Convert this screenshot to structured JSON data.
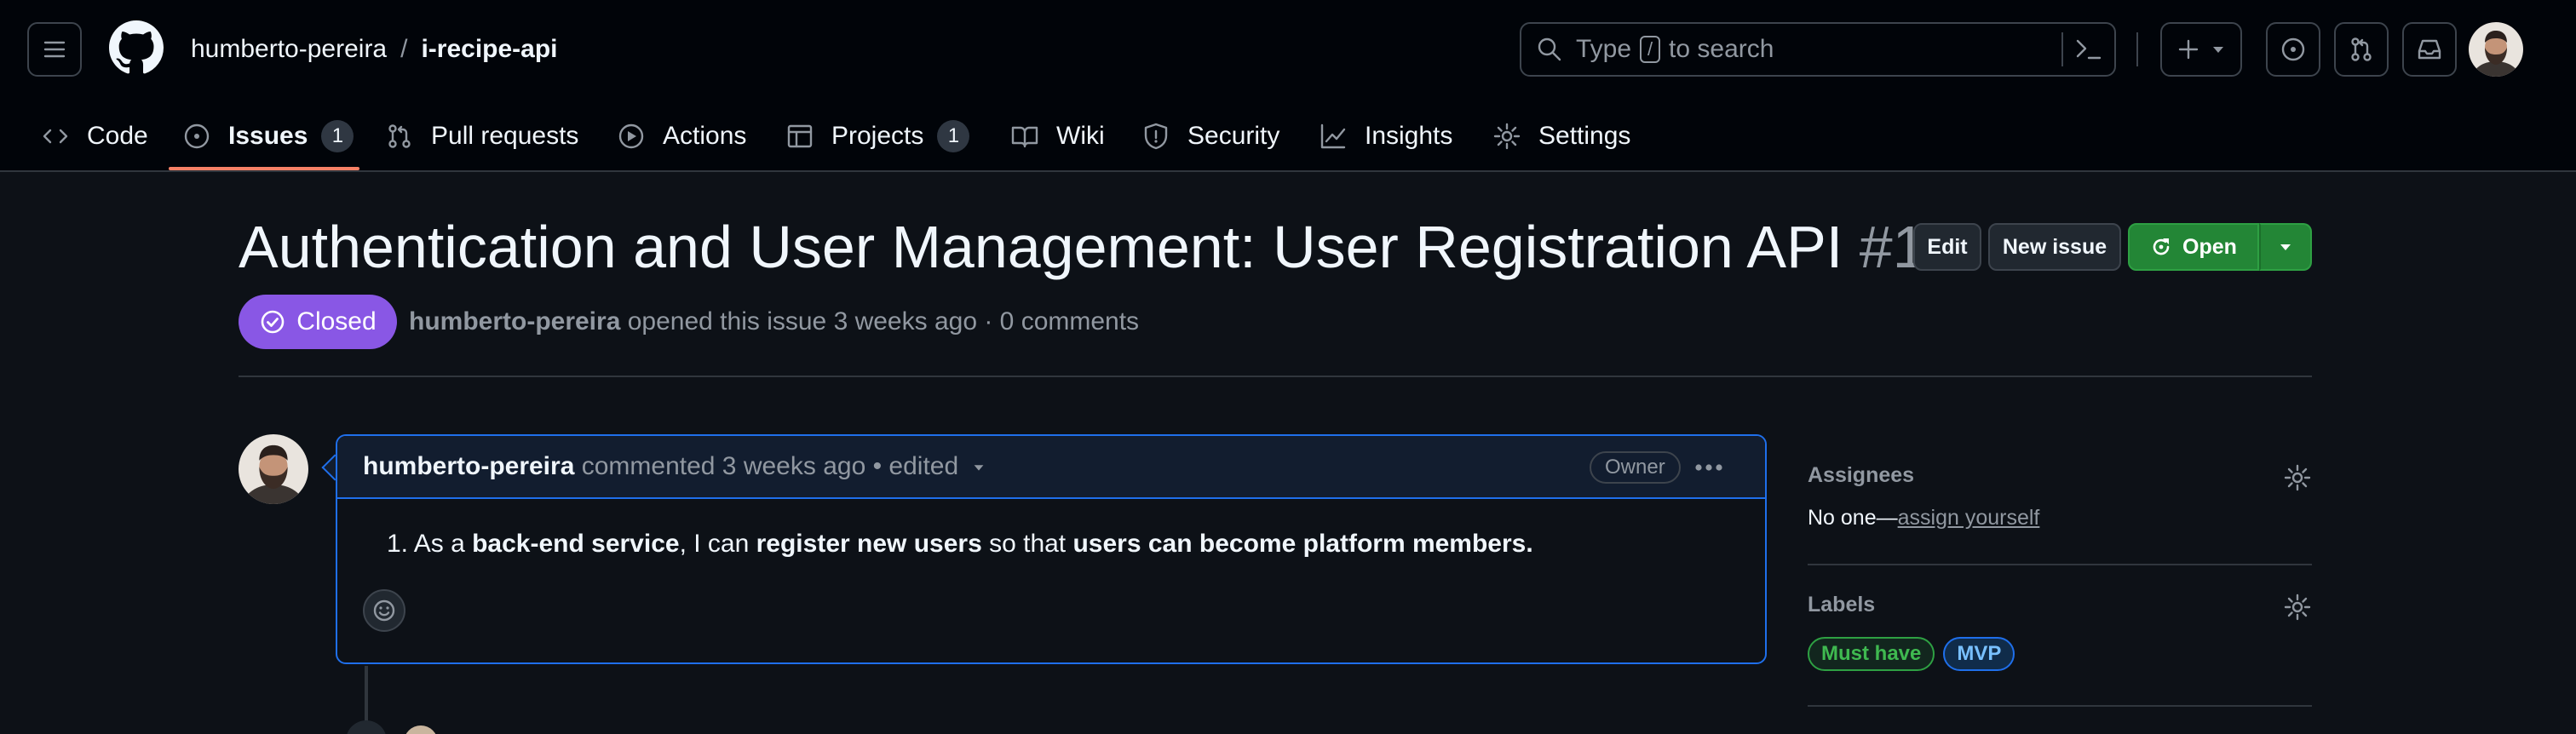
{
  "header": {
    "owner": "humberto-pereira",
    "separator": "/",
    "repo": "i-recipe-api",
    "search_prefix": "Type",
    "search_key": "/",
    "search_suffix": "to search"
  },
  "nav": {
    "tabs": [
      {
        "label": "Code",
        "icon": "code-icon"
      },
      {
        "label": "Issues",
        "icon": "issue-opened-icon",
        "count": "1",
        "selected": true
      },
      {
        "label": "Pull requests",
        "icon": "git-pull-request-icon"
      },
      {
        "label": "Actions",
        "icon": "play-icon"
      },
      {
        "label": "Projects",
        "icon": "table-icon",
        "count": "1"
      },
      {
        "label": "Wiki",
        "icon": "book-icon"
      },
      {
        "label": "Security",
        "icon": "shield-icon"
      },
      {
        "label": "Insights",
        "icon": "graph-icon"
      },
      {
        "label": "Settings",
        "icon": "gear-icon"
      }
    ]
  },
  "issue": {
    "title": "Authentication and User Management: User Registration API",
    "number": "#1",
    "state": "Closed",
    "author": "humberto-pereira",
    "opened_text": "opened this issue 3 weeks ago · 0 comments",
    "actions": {
      "edit": "Edit",
      "new_issue": "New issue",
      "reopen": "Open"
    }
  },
  "comment": {
    "author": "humberto-pereira",
    "meta": "commented 3 weeks ago • edited",
    "role_badge": "Owner",
    "body": {
      "item_number": "1.",
      "p1": "As a ",
      "b1": "back-end service",
      "p2": ", I can ",
      "b2": "register new users",
      "p3": " so that ",
      "b3": "users can become platform members."
    }
  },
  "sidebar": {
    "assignees": {
      "heading": "Assignees",
      "value": "No one—",
      "link": "assign yourself"
    },
    "labels": {
      "heading": "Labels",
      "items": [
        {
          "name": "Must have",
          "color": "#3fb950",
          "bg": "#12261e",
          "border": "#2ea043"
        },
        {
          "name": "MVP",
          "color": "#79c0ff",
          "bg": "#102c4a",
          "border": "#1f6feb"
        }
      ]
    }
  },
  "colors": {
    "accent_closed": "#8957e5",
    "accent_open_button": "#238636",
    "nav_underline": "#f78166",
    "focus_border": "#1f6feb"
  }
}
